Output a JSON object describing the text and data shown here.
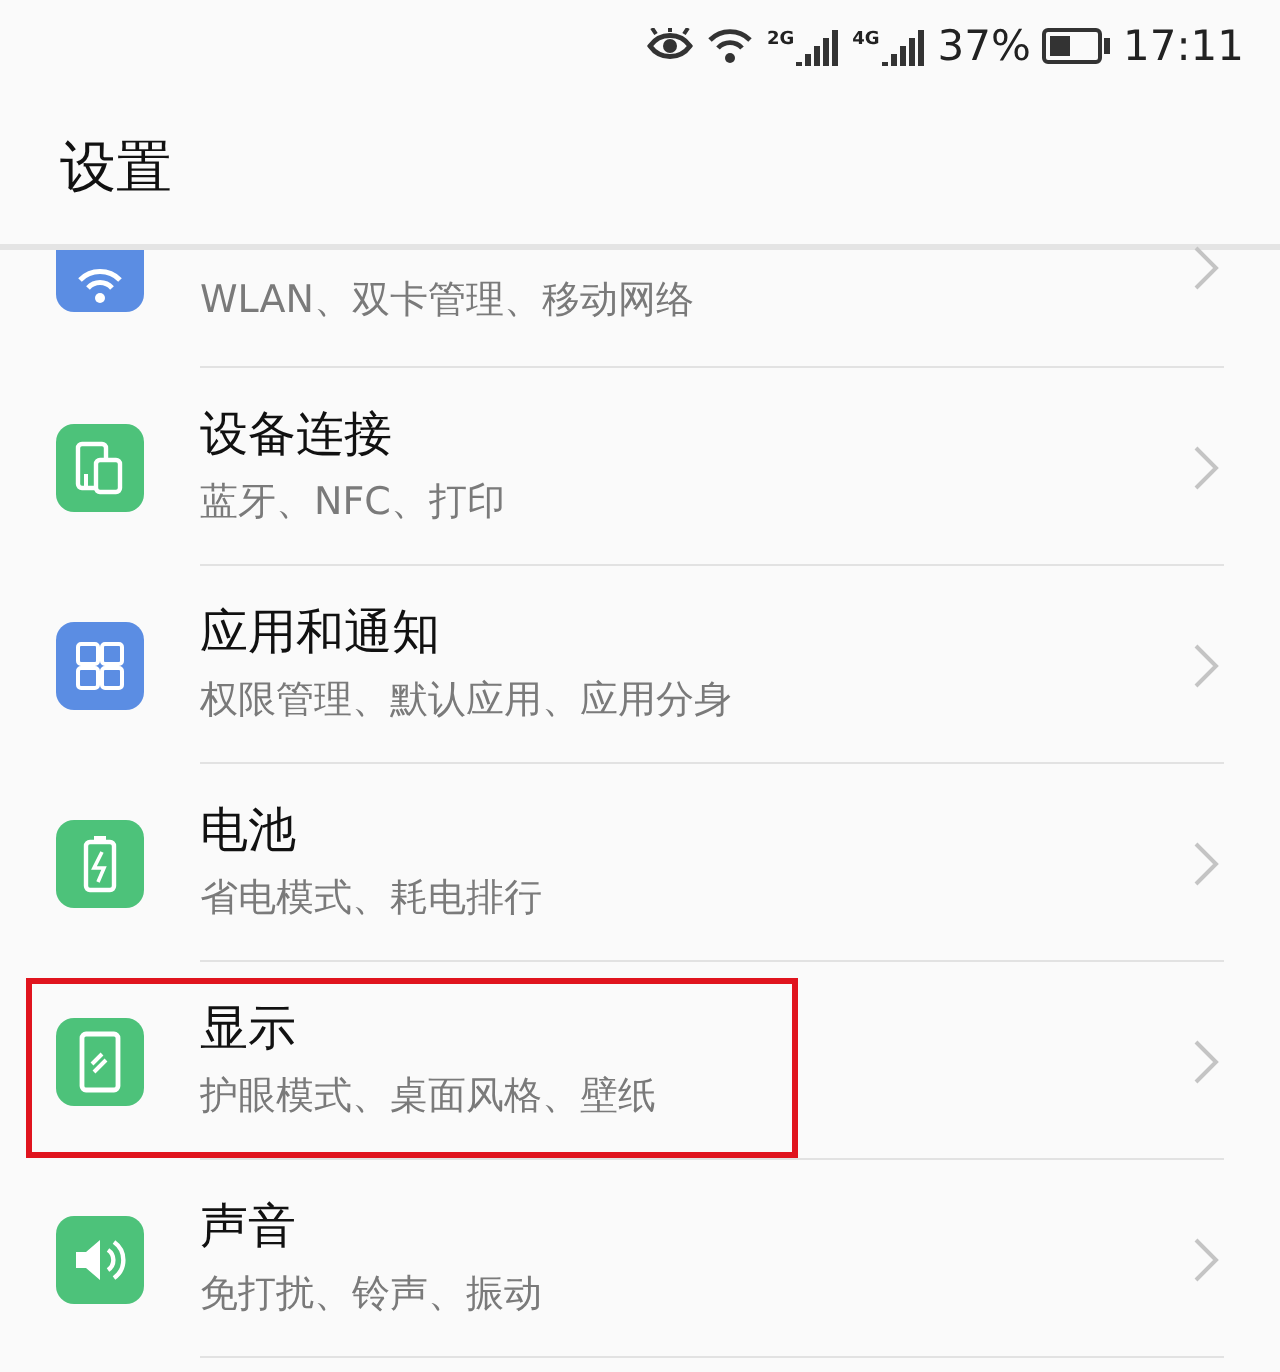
{
  "status_bar": {
    "network_1": "2G",
    "network_2": "4G",
    "battery": "37%",
    "time": "17:11"
  },
  "header": {
    "title": "设置"
  },
  "items": [
    {
      "kind": "partial",
      "subtitle": "WLAN、双卡管理、移动网络",
      "color": "#5b8de3",
      "highlighted": false
    },
    {
      "kind": "full",
      "title": "设备连接",
      "subtitle": "蓝牙、NFC、打印",
      "color": "#4dc27a",
      "highlighted": false
    },
    {
      "kind": "full",
      "title": "应用和通知",
      "subtitle": "权限管理、默认应用、应用分身",
      "color": "#5b8de3",
      "highlighted": false
    },
    {
      "kind": "full",
      "title": "电池",
      "subtitle": "省电模式、耗电排行",
      "color": "#4dc27a",
      "highlighted": false
    },
    {
      "kind": "full",
      "title": "显示",
      "subtitle": "护眼模式、桌面风格、壁纸",
      "color": "#4dc27a",
      "highlighted": true
    },
    {
      "kind": "full",
      "title": "声音",
      "subtitle": "免打扰、铃声、振动",
      "color": "#4dc27a",
      "highlighted": false
    }
  ]
}
